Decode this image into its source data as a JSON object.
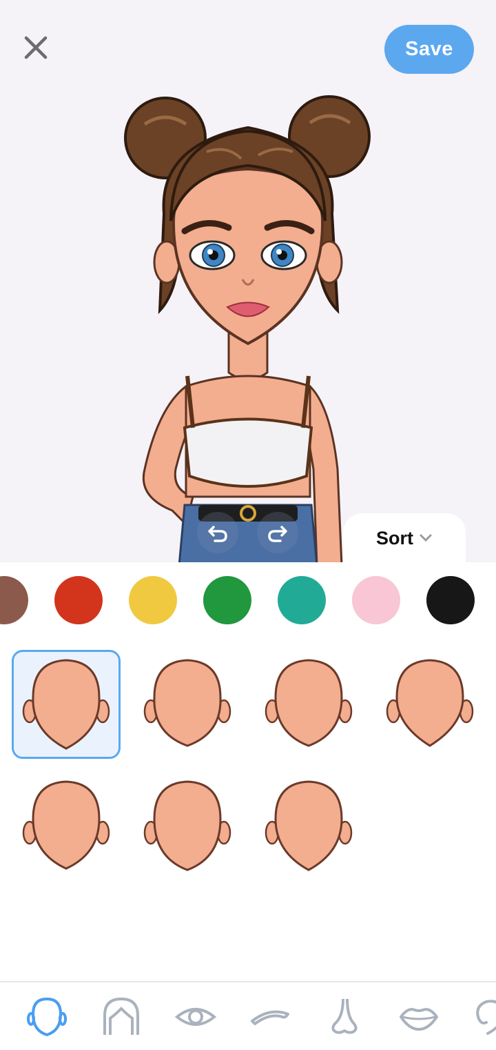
{
  "header": {
    "save_label": "Save",
    "close_icon": "close-icon"
  },
  "sort": {
    "label": "Sort",
    "icon": "chevron-down-icon"
  },
  "colors": {
    "swatches": [
      "#8b5a4d",
      "#d2341c",
      "#f0c940",
      "#21973e",
      "#21ab97",
      "#f8c6d4",
      "#171717"
    ],
    "accent": "#5ba8ef",
    "skin": "#f3ad8f"
  },
  "face_shapes": {
    "count": 7,
    "selected_index": 0
  },
  "bottom_nav": {
    "items": [
      "face-icon",
      "hair-icon",
      "eye-icon",
      "eyebrow-icon",
      "nose-icon",
      "lips-icon",
      "ear-icon"
    ],
    "active_index": 0
  }
}
